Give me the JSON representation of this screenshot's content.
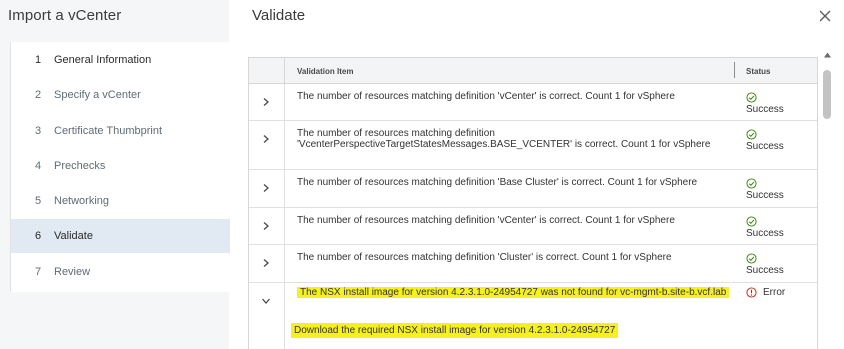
{
  "wizard": {
    "title": "Import a vCenter",
    "steps": [
      {
        "num": "1",
        "label": "General Information"
      },
      {
        "num": "2",
        "label": "Specify a vCenter"
      },
      {
        "num": "3",
        "label": "Certificate Thumbprint"
      },
      {
        "num": "4",
        "label": "Prechecks"
      },
      {
        "num": "5",
        "label": "Networking"
      },
      {
        "num": "6",
        "label": "Validate"
      },
      {
        "num": "7",
        "label": "Review"
      }
    ],
    "current_step": "Validate"
  },
  "page": {
    "title": "Validate",
    "close_icon": "close-icon"
  },
  "grid": {
    "columns": {
      "item": "Validation Item",
      "status": "Status"
    },
    "rows": [
      {
        "message": "The number of resources matching definition 'vCenter' is correct. Count 1 for vSphere",
        "status": "Success",
        "expanded": false
      },
      {
        "message": "The number of resources matching definition 'VcenterPerspectiveTargetStatesMessages.BASE_VCENTER' is correct. Count 1 for vSphere",
        "status": "Success",
        "expanded": false
      },
      {
        "message": "The number of resources matching definition 'Base Cluster' is correct. Count 1 for vSphere",
        "status": "Success",
        "expanded": false
      },
      {
        "message": "The number of resources matching definition 'vCenter' is correct. Count 1 for vSphere",
        "status": "Success",
        "expanded": false
      },
      {
        "message": "The number of resources matching definition 'Cluster' is correct. Count 1 for vSphere",
        "status": "Success",
        "expanded": false
      },
      {
        "message": "The NSX install image for version 4.2.3.1.0-24954727 was not found for vc-mgmt-b.site-b.vcf.lab",
        "status": "Error",
        "expanded": true,
        "detail": "Download the required NSX install image for version 4.2.3.1.0-24954727"
      }
    ]
  },
  "colors": {
    "success": "#2f8400",
    "error": "#c92100",
    "highlight": "#f5f11e",
    "selected_step": "#e1eaf2"
  }
}
